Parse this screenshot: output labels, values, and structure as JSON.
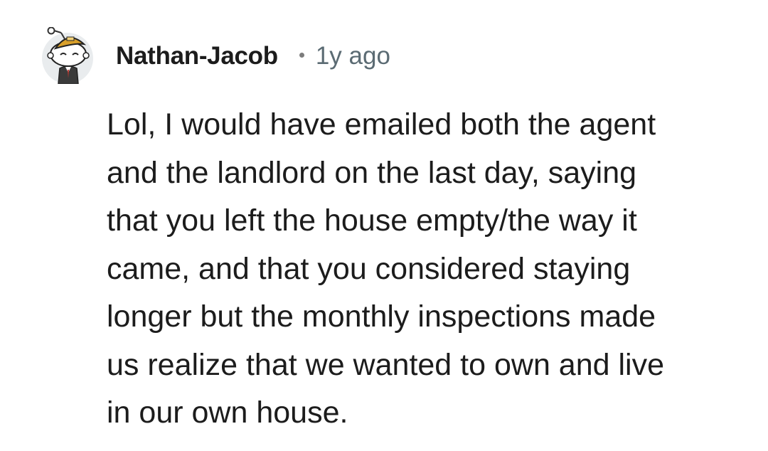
{
  "comment": {
    "avatar_icon": "snoo-avatar-icon",
    "username": "Nathan-Jacob",
    "separator": "•",
    "timestamp": "1y ago",
    "body_lines": [
      "Lol, I would have emailed both the agent",
      "and the landlord on the last day, saying",
      "that you left the house empty/the way it",
      "came, and that you considered staying",
      "longer but the monthly inspections made",
      "us realize that we wanted to own and live",
      "in our own house."
    ]
  },
  "colors": {
    "background": "#ffffff",
    "text": "#1c1c1c",
    "muted": "#5b6b73",
    "avatar_bg": "#e9ecee",
    "hat": "#d9a02a"
  }
}
